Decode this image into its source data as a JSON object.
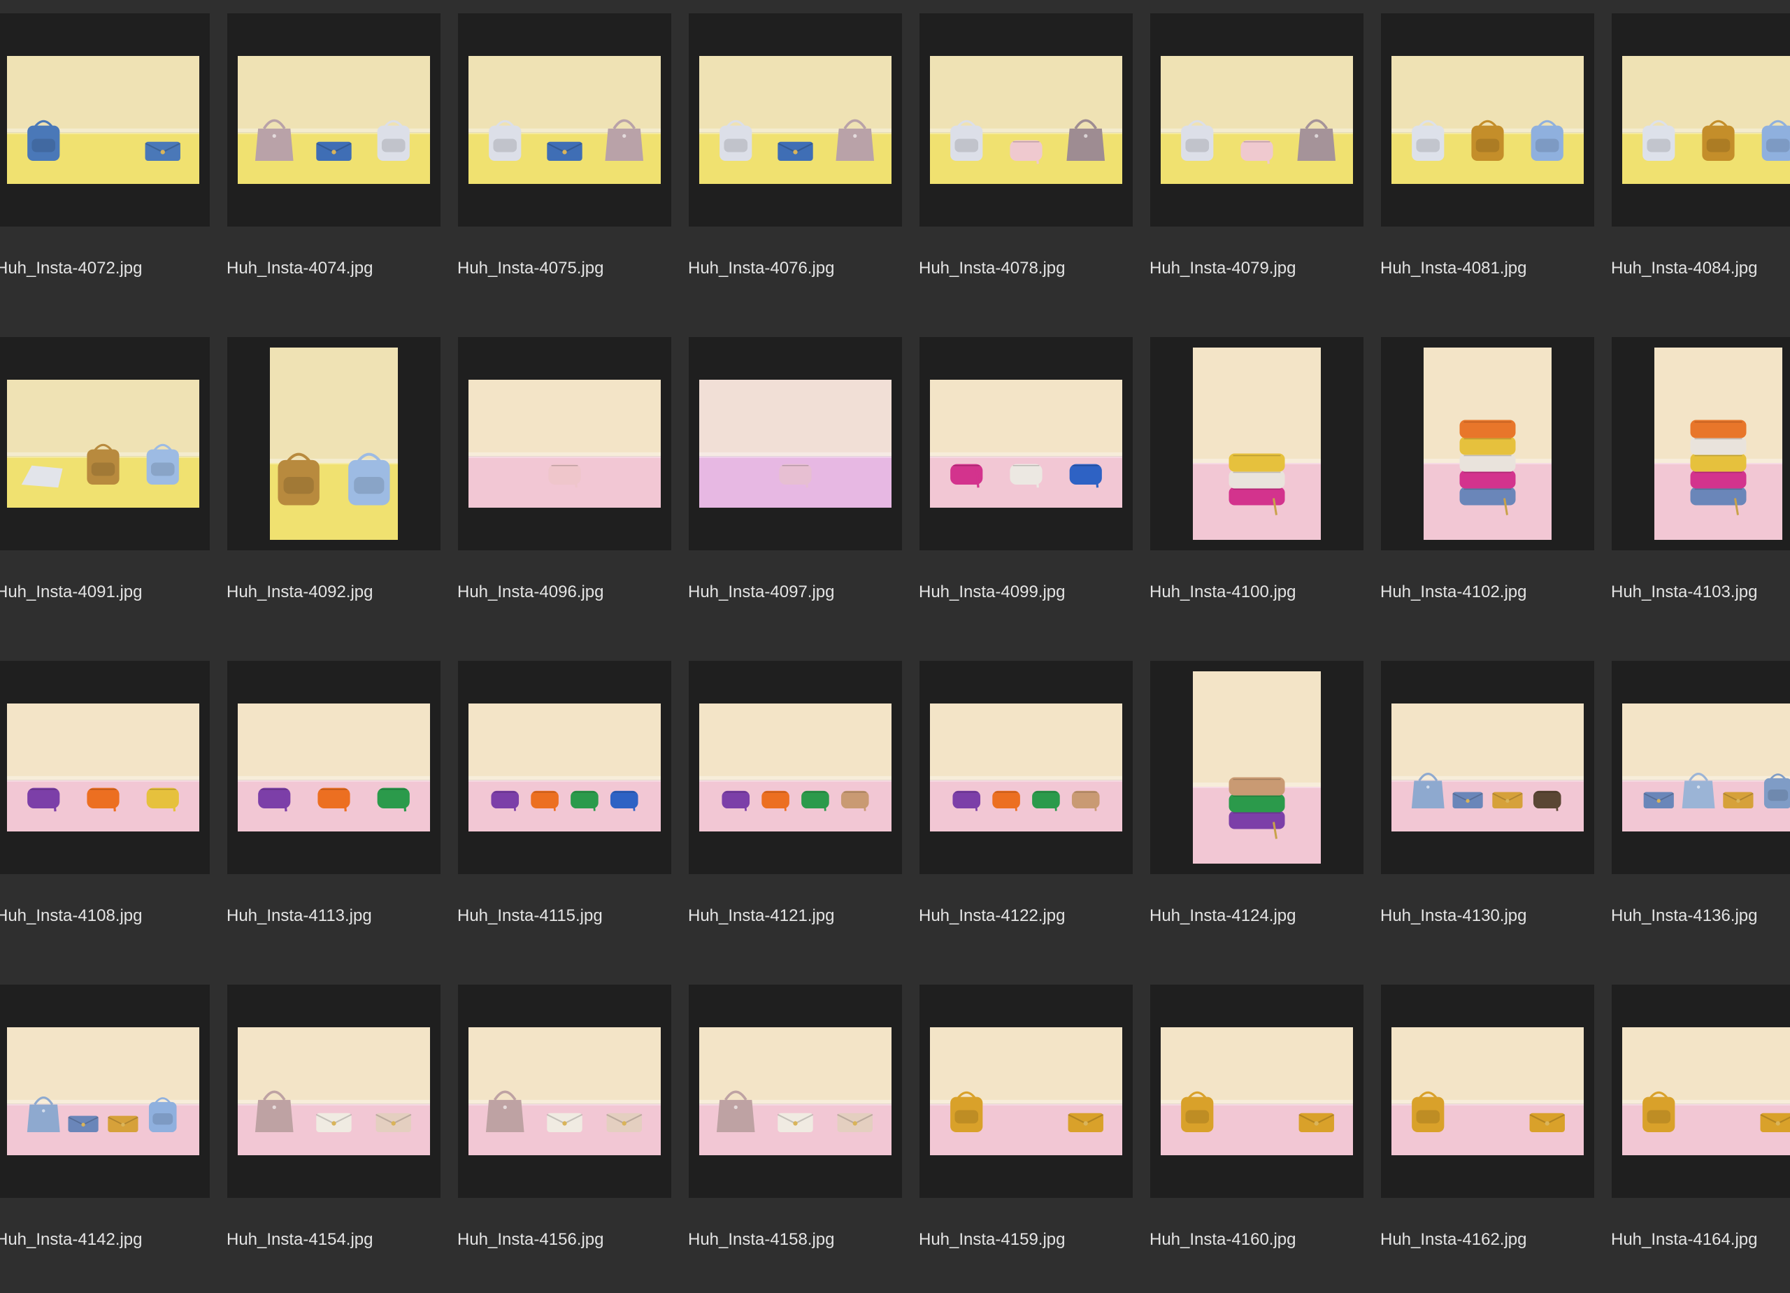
{
  "files": [
    {
      "name": "Huh_Insta-4072.jpg",
      "orient": "landscape",
      "bg": "yellow",
      "items": [
        {
          "shape": "backpack",
          "color": "#4a78b8"
        },
        {
          "shape": "clutch",
          "color": "#4a78b8"
        }
      ]
    },
    {
      "name": "Huh_Insta-4074.jpg",
      "orient": "landscape",
      "bg": "yellow",
      "items": [
        {
          "shape": "tote",
          "color": "#b9a2a8"
        },
        {
          "shape": "clutch",
          "color": "#3f6eb5"
        },
        {
          "shape": "backpack",
          "color": "#dcdfe8"
        }
      ]
    },
    {
      "name": "Huh_Insta-4075.jpg",
      "orient": "landscape",
      "bg": "yellow",
      "items": [
        {
          "shape": "backpack",
          "color": "#dcdfe8"
        },
        {
          "shape": "clutch",
          "color": "#3f6eb5"
        },
        {
          "shape": "tote",
          "color": "#b9a2a8"
        }
      ]
    },
    {
      "name": "Huh_Insta-4076.jpg",
      "orient": "landscape",
      "bg": "yellow",
      "items": [
        {
          "shape": "backpack",
          "color": "#dcdfe8"
        },
        {
          "shape": "clutch",
          "color": "#3f6eb5"
        },
        {
          "shape": "tote",
          "color": "#b9a2a8"
        }
      ]
    },
    {
      "name": "Huh_Insta-4078.jpg",
      "orient": "landscape",
      "bg": "yellow",
      "items": [
        {
          "shape": "backpack",
          "color": "#dcdfe8"
        },
        {
          "shape": "pouch",
          "color": "#efc9cf"
        },
        {
          "shape": "tote",
          "color": "#9e8c92"
        }
      ]
    },
    {
      "name": "Huh_Insta-4079.jpg",
      "orient": "landscape",
      "bg": "yellow",
      "items": [
        {
          "shape": "backpack",
          "color": "#dcdfe8"
        },
        {
          "shape": "pouch",
          "color": "#efc9cf"
        },
        {
          "shape": "tote",
          "color": "#a59399"
        }
      ]
    },
    {
      "name": "Huh_Insta-4081.jpg",
      "orient": "landscape",
      "bg": "yellow",
      "items": [
        {
          "shape": "backpack",
          "color": "#dde1ea"
        },
        {
          "shape": "backpack",
          "color": "#c48e2a"
        },
        {
          "shape": "backpack",
          "color": "#8fb0de"
        }
      ]
    },
    {
      "name": "Huh_Insta-4084.jpg",
      "orient": "landscape",
      "bg": "yellow",
      "items": [
        {
          "shape": "backpack",
          "color": "#dde1ea"
        },
        {
          "shape": "backpack",
          "color": "#c48e2a"
        },
        {
          "shape": "backpack",
          "color": "#8fb0de"
        }
      ]
    },
    {
      "name": "Huh_Insta-4091.jpg",
      "orient": "landscape",
      "bg": "yellow",
      "items": [
        {
          "shape": "laptop",
          "color": "#e2e4ea"
        },
        {
          "shape": "backpack",
          "color": "#b88a3e"
        },
        {
          "shape": "backpack",
          "color": "#9dbbe3"
        }
      ]
    },
    {
      "name": "Huh_Insta-4092.jpg",
      "orient": "portrait",
      "bg": "yellow",
      "items": [
        {
          "shape": "backpack",
          "color": "#b88a3e"
        },
        {
          "shape": "backpack",
          "color": "#9dbbe3"
        }
      ]
    },
    {
      "name": "Huh_Insta-4096.jpg",
      "orient": "landscape",
      "bg": "pink",
      "items": [
        {
          "shape": "pouch",
          "color": "#efc6cb"
        }
      ]
    },
    {
      "name": "Huh_Insta-4097.jpg",
      "orient": "landscape",
      "bg": "lilac",
      "items": [
        {
          "shape": "pouch",
          "color": "#e7bfd2"
        }
      ]
    },
    {
      "name": "Huh_Insta-4099.jpg",
      "orient": "landscape",
      "bg": "pink",
      "items": [
        {
          "shape": "pouch",
          "color": "#d3338d"
        },
        {
          "shape": "pouch",
          "color": "#ece8e2"
        },
        {
          "shape": "pouch",
          "color": "#2e62c4"
        }
      ]
    },
    {
      "name": "Huh_Insta-4100.jpg",
      "orient": "portrait",
      "bg": "pink",
      "items": [
        {
          "shape": "stack",
          "colors": [
            "#d3338d",
            "#e9e3dc",
            "#e6c13d"
          ]
        }
      ]
    },
    {
      "name": "Huh_Insta-4102.jpg",
      "orient": "portrait",
      "bg": "pink",
      "items": [
        {
          "shape": "stack",
          "colors": [
            "#6a86b9",
            "#d3338d",
            "#e9e3dc",
            "#e6c13d",
            "#e8762a"
          ]
        }
      ]
    },
    {
      "name": "Huh_Insta-4103.jpg",
      "orient": "portrait",
      "bg": "pink",
      "items": [
        {
          "shape": "stack",
          "colors": [
            "#6a86b9",
            "#d3338d",
            "#e6c13d",
            "#e9e3dc",
            "#e8762a"
          ]
        }
      ]
    },
    {
      "name": "Huh_Insta-4108.jpg",
      "orient": "landscape",
      "bg": "pink",
      "items": [
        {
          "shape": "pouch",
          "color": "#7c3fa8"
        },
        {
          "shape": "pouch",
          "color": "#ec6f21"
        },
        {
          "shape": "pouch",
          "color": "#e6c13d"
        }
      ]
    },
    {
      "name": "Huh_Insta-4113.jpg",
      "orient": "landscape",
      "bg": "pink",
      "items": [
        {
          "shape": "pouch",
          "color": "#7c3fa8"
        },
        {
          "shape": "pouch",
          "color": "#ec6f21"
        },
        {
          "shape": "pouch",
          "color": "#2b9a4b"
        }
      ]
    },
    {
      "name": "Huh_Insta-4115.jpg",
      "orient": "landscape",
      "bg": "pink",
      "items": [
        {
          "shape": "pouch",
          "color": "#7c3fa8"
        },
        {
          "shape": "pouch",
          "color": "#ec6f21"
        },
        {
          "shape": "pouch",
          "color": "#2b9a4b"
        },
        {
          "shape": "pouch",
          "color": "#2e62c4"
        }
      ]
    },
    {
      "name": "Huh_Insta-4121.jpg",
      "orient": "landscape",
      "bg": "pink",
      "items": [
        {
          "shape": "pouch",
          "color": "#7c3fa8"
        },
        {
          "shape": "pouch",
          "color": "#ec6f21"
        },
        {
          "shape": "pouch",
          "color": "#2b9a4b"
        },
        {
          "shape": "pouch",
          "color": "#c99a73"
        }
      ]
    },
    {
      "name": "Huh_Insta-4122.jpg",
      "orient": "landscape",
      "bg": "pink",
      "items": [
        {
          "shape": "pouch",
          "color": "#7c3fa8"
        },
        {
          "shape": "pouch",
          "color": "#ec6f21"
        },
        {
          "shape": "pouch",
          "color": "#2b9a4b"
        },
        {
          "shape": "pouch",
          "color": "#c99a73"
        }
      ]
    },
    {
      "name": "Huh_Insta-4124.jpg",
      "orient": "portrait",
      "bg": "pink",
      "items": [
        {
          "shape": "stack",
          "colors": [
            "#7c3fa8",
            "#2b9a4b",
            "#c99a73"
          ]
        }
      ]
    },
    {
      "name": "Huh_Insta-4130.jpg",
      "orient": "landscape",
      "bg": "pink",
      "items": [
        {
          "shape": "tote",
          "color": "#8ea9cf"
        },
        {
          "shape": "clutch",
          "color": "#6a86b9"
        },
        {
          "shape": "clutch",
          "color": "#d6a13a"
        },
        {
          "shape": "pouch",
          "color": "#5a4634"
        }
      ]
    },
    {
      "name": "Huh_Insta-4136.jpg",
      "orient": "landscape",
      "bg": "pink",
      "items": [
        {
          "shape": "clutch",
          "color": "#6a86b9"
        },
        {
          "shape": "tote",
          "color": "#9bb4d6"
        },
        {
          "shape": "clutch",
          "color": "#d6a13a"
        },
        {
          "shape": "backpack",
          "color": "#7f9cc6"
        }
      ]
    },
    {
      "name": "Huh_Insta-4142.jpg",
      "orient": "landscape",
      "bg": "pink",
      "items": [
        {
          "shape": "tote",
          "color": "#8ea9cf"
        },
        {
          "shape": "clutch",
          "color": "#6a86b9"
        },
        {
          "shape": "clutch",
          "color": "#d6a13a"
        },
        {
          "shape": "backpack",
          "color": "#8fb0de"
        }
      ]
    },
    {
      "name": "Huh_Insta-4154.jpg",
      "orient": "landscape",
      "bg": "pink",
      "items": [
        {
          "shape": "tote",
          "color": "#bea2a3"
        },
        {
          "shape": "clutch",
          "color": "#f0ebe2"
        },
        {
          "shape": "clutch",
          "color": "#e4cfc0"
        }
      ]
    },
    {
      "name": "Huh_Insta-4156.jpg",
      "orient": "landscape",
      "bg": "pink",
      "items": [
        {
          "shape": "tote",
          "color": "#bea2a3"
        },
        {
          "shape": "clutch",
          "color": "#f0ebe2"
        },
        {
          "shape": "clutch",
          "color": "#e4cfc0"
        }
      ]
    },
    {
      "name": "Huh_Insta-4158.jpg",
      "orient": "landscape",
      "bg": "pink",
      "items": [
        {
          "shape": "tote",
          "color": "#bea2a3"
        },
        {
          "shape": "clutch",
          "color": "#f0ebe2"
        },
        {
          "shape": "clutch",
          "color": "#e4cfc0"
        }
      ]
    },
    {
      "name": "Huh_Insta-4159.jpg",
      "orient": "landscape",
      "bg": "pink",
      "items": [
        {
          "shape": "backpack",
          "color": "#d9a12a"
        },
        {
          "shape": "clutch",
          "color": "#d9a12a"
        }
      ]
    },
    {
      "name": "Huh_Insta-4160.jpg",
      "orient": "landscape",
      "bg": "pink",
      "items": [
        {
          "shape": "backpack",
          "color": "#d9a12a"
        },
        {
          "shape": "clutch",
          "color": "#d9a12a"
        }
      ]
    },
    {
      "name": "Huh_Insta-4162.jpg",
      "orient": "landscape",
      "bg": "pink",
      "items": [
        {
          "shape": "backpack",
          "color": "#d9a12a"
        },
        {
          "shape": "clutch",
          "color": "#d9a12a"
        }
      ]
    },
    {
      "name": "Huh_Insta-4164.jpg",
      "orient": "landscape",
      "bg": "pink",
      "items": [
        {
          "shape": "backpack",
          "color": "#d9a12a"
        },
        {
          "shape": "clutch",
          "color": "#d9a12a"
        }
      ]
    }
  ],
  "backgrounds": {
    "yellow": {
      "wall": "#efe2b4",
      "floor": "#f0e170"
    },
    "pink": {
      "wall": "#f3e4c7",
      "floor": "#f2c7d4"
    },
    "lilac": {
      "wall": "#f1dfd6",
      "floor": "#e7b8e3"
    }
  },
  "colors": {
    "window_bg": "#2f2f2f",
    "thumb_frame": "#1f1f1f",
    "filename_text": "#e4e4e4"
  }
}
